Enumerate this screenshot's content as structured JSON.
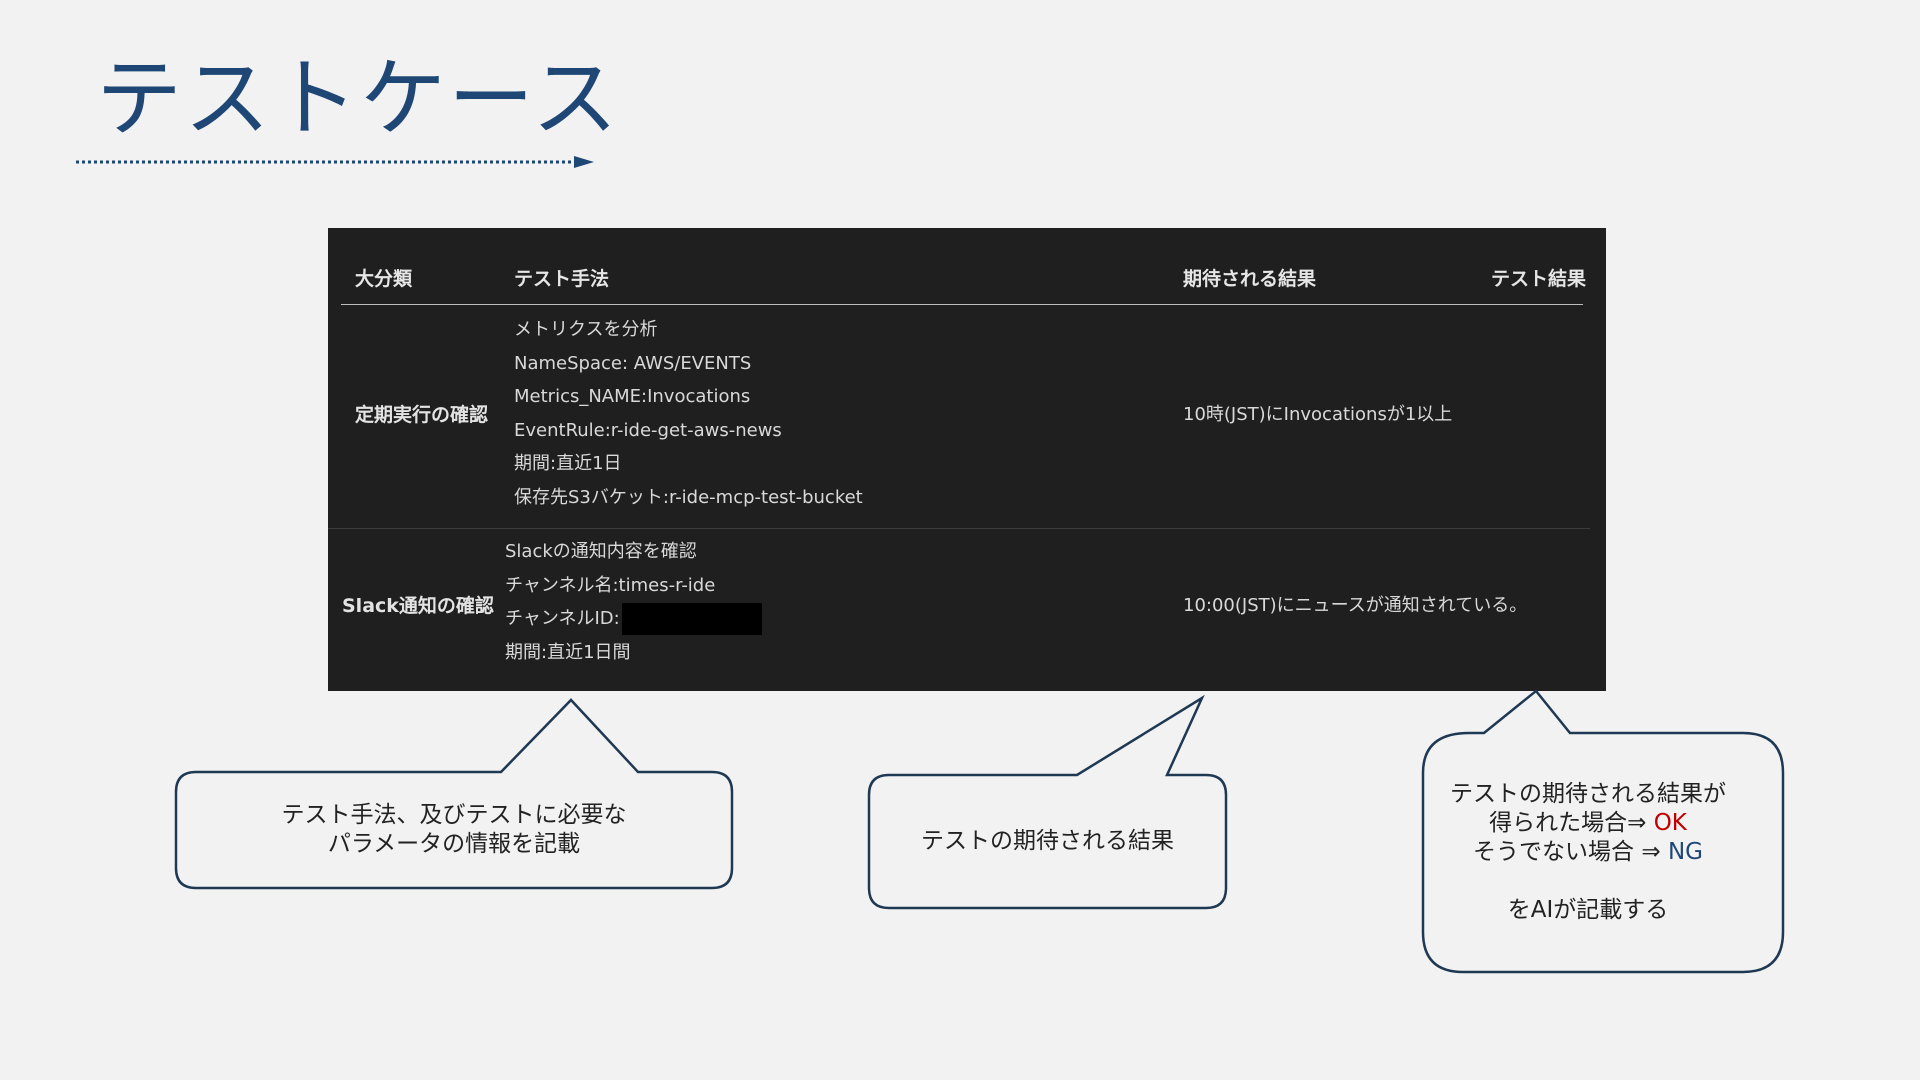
{
  "title": "テストケース",
  "accent_color": "#1f4776",
  "table": {
    "headers": {
      "category": "大分類",
      "method": "テスト手法",
      "expected": "期待される結果",
      "result": "テスト結果"
    },
    "rows": [
      {
        "category": "定期実行の確認",
        "method_lines": [
          "メトリクスを分析",
          "NameSpace: AWS/EVENTS",
          "Metrics_NAME:Invocations",
          "EventRule:r-ide-get-aws-news",
          "期間:直近1日",
          "保存先S3バケット:r-ide-mcp-test-bucket"
        ],
        "expected": "10時(JST)にInvocationsが1以上",
        "result": ""
      },
      {
        "category": "Slack通知の確認",
        "method_lines": [
          "Slackの通知内容を確認",
          "チャンネル名:times-r-ide",
          "チャンネルID:",
          "期間:直近1日間"
        ],
        "expected": "10:00(JST)にニュースが通知されている。",
        "result": ""
      }
    ]
  },
  "callouts": {
    "method": {
      "line1": "テスト手法、及びテストに必要な",
      "line2": "パラメータの情報を記載"
    },
    "expected": {
      "text": "テストの期待される結果"
    },
    "result": {
      "line1": "テストの期待される結果が",
      "line2_prefix": "得られた場合⇒ ",
      "ok": "OK",
      "line3_prefix": "そうでない場合 ⇒ ",
      "ng": "NG",
      "line4": "をAIが記載する",
      "ok_color": "#c00000",
      "ng_color": "#1f4776"
    }
  }
}
